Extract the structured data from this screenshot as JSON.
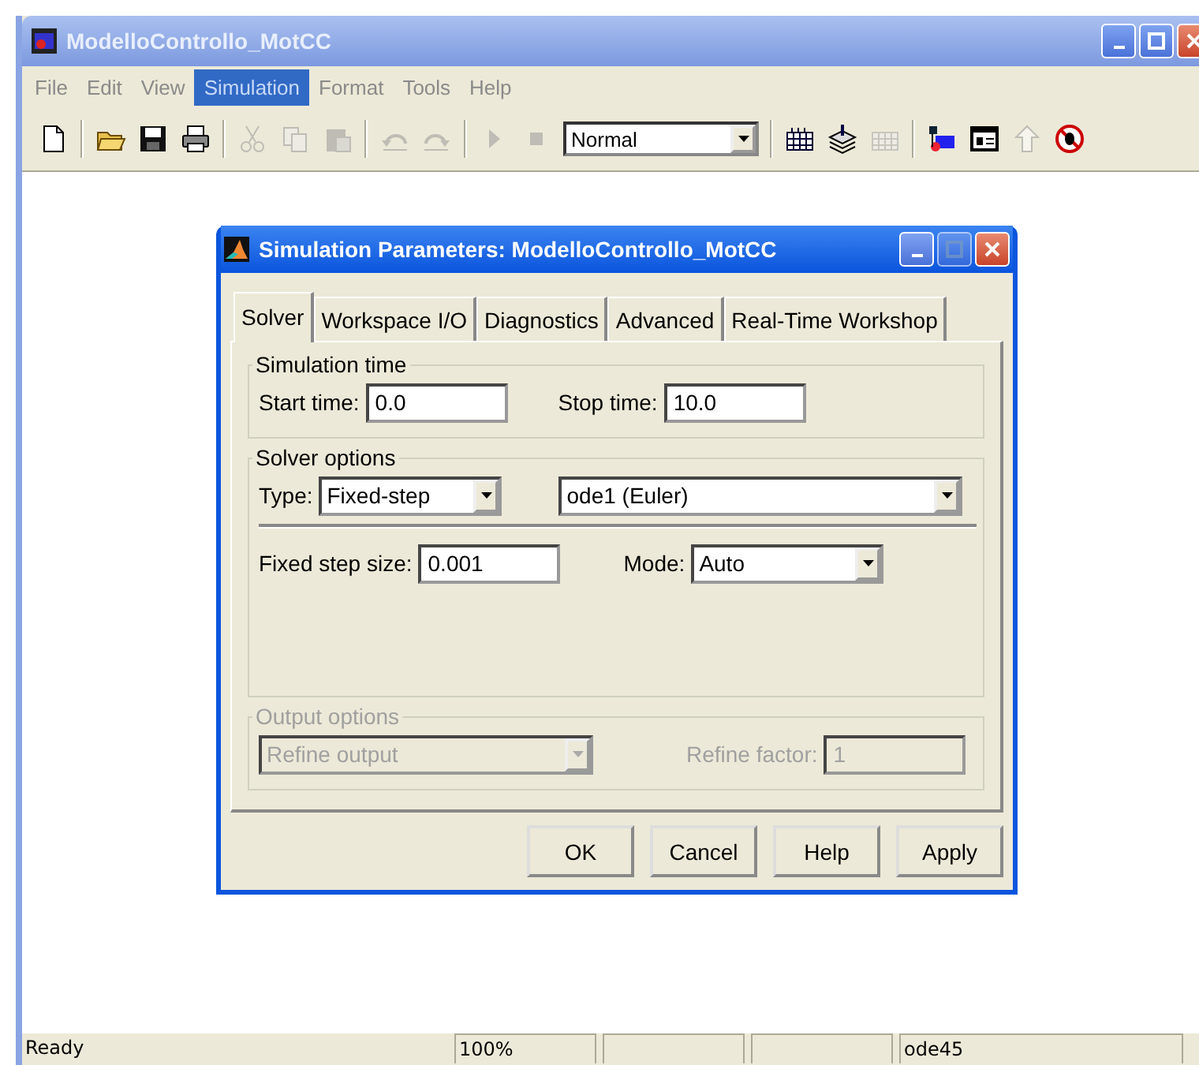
{
  "window": {
    "title": "ModelloControllo_MotCC"
  },
  "menu": [
    {
      "label": "File",
      "selected": false
    },
    {
      "label": "Edit",
      "selected": false
    },
    {
      "label": "View",
      "selected": false
    },
    {
      "label": "Simulation",
      "selected": true
    },
    {
      "label": "Format",
      "selected": false
    },
    {
      "label": "Tools",
      "selected": false
    },
    {
      "label": "Help",
      "selected": false
    }
  ],
  "toolbar": [
    {
      "kind": "button",
      "disabled": false
    },
    {
      "kind": "separator"
    },
    {
      "kind": "button",
      "disabled": false
    },
    {
      "kind": "button",
      "disabled": false
    },
    {
      "kind": "button",
      "disabled": false
    },
    {
      "kind": "separator"
    },
    {
      "kind": "button",
      "disabled": true
    },
    {
      "kind": "button",
      "disabled": true
    },
    {
      "kind": "button",
      "disabled": true
    },
    {
      "kind": "separator"
    },
    {
      "kind": "button",
      "disabled": true
    },
    {
      "kind": "button",
      "disabled": true
    },
    {
      "kind": "separator"
    },
    {
      "kind": "button",
      "disabled": true
    },
    {
      "kind": "button",
      "disabled": true
    },
    {
      "kind": "dropdown",
      "value": "Normal"
    },
    {
      "kind": "separator"
    },
    {
      "kind": "button",
      "disabled": false
    },
    {
      "kind": "button",
      "disabled": false
    },
    {
      "kind": "button",
      "disabled": true
    },
    {
      "kind": "separator"
    },
    {
      "kind": "button",
      "disabled": false
    },
    {
      "kind": "button",
      "disabled": false
    },
    {
      "kind": "button",
      "disabled": true
    },
    {
      "kind": "button",
      "disabled": false
    }
  ],
  "dialog": {
    "title": "Simulation Parameters: ModelloControllo_MotCC",
    "tabs": [
      {
        "label": "Solver",
        "selected": true
      },
      {
        "label": "Workspace I/O",
        "selected": false
      },
      {
        "label": "Diagnostics",
        "selected": false
      },
      {
        "label": "Advanced",
        "selected": false
      },
      {
        "label": "Real-Time Workshop",
        "selected": false
      }
    ],
    "simulation_time": {
      "title": "Simulation time",
      "start_label": "Start time:",
      "start_value": "0.0",
      "stop_label": "Stop time:",
      "stop_value": "10.0"
    },
    "solver_options": {
      "title": "Solver options",
      "type_label": "Type:",
      "type_value": "Fixed-step",
      "solver_value": "ode1 (Euler)",
      "step_label": "Fixed step size:",
      "step_value": "0.001",
      "mode_label": "Mode:",
      "mode_value": "Auto"
    },
    "output_options": {
      "title": "Output options",
      "disabled": true,
      "refine_value": "Refine output",
      "factor_label": "Refine factor:",
      "factor_value": "1"
    },
    "buttons": [
      "OK",
      "Cancel",
      "Help",
      "Apply"
    ]
  },
  "status_bar": {
    "message": "Ready",
    "zoom": "100%",
    "solver": "ode45"
  }
}
